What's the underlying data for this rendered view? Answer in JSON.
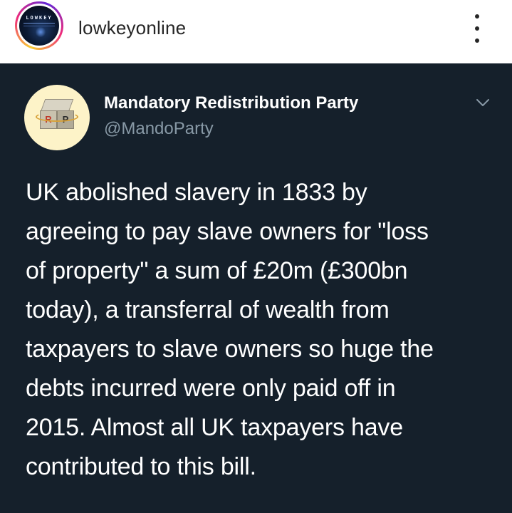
{
  "post": {
    "username": "lowkeyonline",
    "avatar_text": "LOWKEY",
    "more_icon": "more-vertical-icon"
  },
  "tweet": {
    "display_name": "Mandatory Redistribution Party",
    "handle": "@MandoParty",
    "avatar_letters": [
      "R",
      "P"
    ],
    "chevron_icon": "chevron-down-icon",
    "body_lines": [
      "UK abolished slavery in 1833 by",
      "agreeing to pay slave owners for \"loss",
      "of property\" a sum of £20m (£300bn",
      "today), a transferral of wealth from",
      "taxpayers to slave owners so huge the",
      "debts incurred were only paid off in",
      "2015. Almost all UK taxpayers have",
      "contributed to this bill."
    ]
  },
  "colors": {
    "tweet_background": "#15202b",
    "handle_gray": "#8899a6",
    "ig_text": "#262626"
  }
}
